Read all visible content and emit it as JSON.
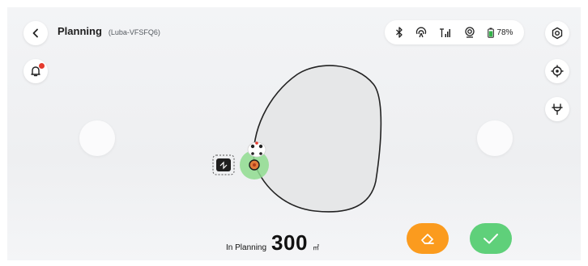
{
  "header": {
    "title": "Planning",
    "device": "(Luba-VFSFQ6)"
  },
  "status_bar": {
    "battery_text": "78%",
    "icons": [
      "bluetooth-icon",
      "rtk-signal-icon",
      "cellular-signal-icon",
      "camera-icon",
      "battery-icon"
    ]
  },
  "bottom_bar": {
    "label": "In Planning",
    "value": "300",
    "unit": "㎡"
  },
  "buttons": {
    "back": "back-icon",
    "notification": "bell-icon",
    "settings": "settings-icon",
    "locate": "locate-icon",
    "charging_station": "charging-station-icon",
    "erase": "eraser-icon",
    "confirm": "checkmark-icon"
  },
  "colors": {
    "erase_button": "#fb9b1e",
    "confirm_button": "#5fd07a",
    "mower_zone": "#8fdc8f",
    "notification_dot": "#e53b2e",
    "boundary": "#222222",
    "area_fill": "#e6e7e8"
  }
}
